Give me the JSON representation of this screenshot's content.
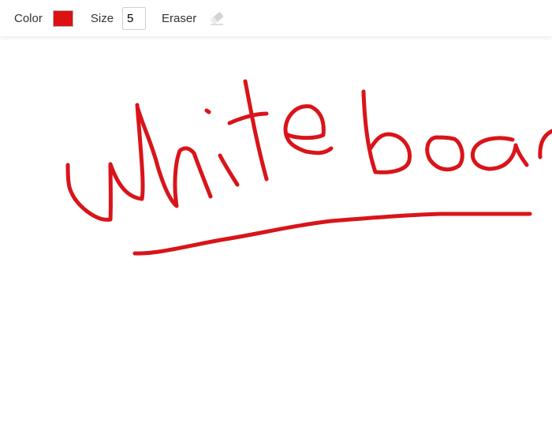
{
  "toolbar": {
    "color_label": "Color",
    "current_color": "#dd1111",
    "size_label": "Size",
    "size_value": "5",
    "eraser_label": "Eraser",
    "eraser_icon": "eraser-icon"
  },
  "canvas": {
    "stroke_color": "#d9141a"
  }
}
